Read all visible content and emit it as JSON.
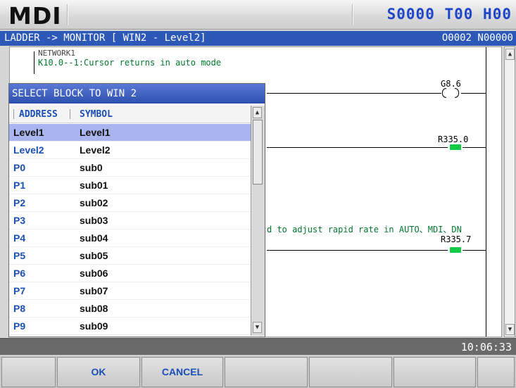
{
  "header": {
    "mode": "MDI",
    "status": "S0000 T00 H00"
  },
  "titlebar": {
    "path": "LADDER -> MONITOR [ WIN2 - Level2]",
    "program": "O0002 N00000"
  },
  "ladder": {
    "network_label": "NETWORK1",
    "comment1": "K10.0--1:Cursor returns in auto mode",
    "comment2": "d to adjust rapid rate in AUTO、MDI、DN",
    "coils": [
      {
        "addr": "G8.6",
        "active": false
      },
      {
        "addr": "R335.0",
        "active": true
      },
      {
        "addr": "R335.7",
        "active": true
      }
    ]
  },
  "dialog": {
    "title": "SELECT BLOCK TO WIN 2",
    "col_address": "ADDRESS",
    "col_symbol": "SYMBOL",
    "rows": [
      {
        "address": "Level1",
        "symbol": "Level1",
        "selected": true
      },
      {
        "address": "Level2",
        "symbol": "Level2",
        "selected": false
      },
      {
        "address": "P0",
        "symbol": "sub0",
        "selected": false
      },
      {
        "address": "P1",
        "symbol": "sub01",
        "selected": false
      },
      {
        "address": "P2",
        "symbol": "sub02",
        "selected": false
      },
      {
        "address": "P3",
        "symbol": "sub03",
        "selected": false
      },
      {
        "address": "P4",
        "symbol": "sub04",
        "selected": false
      },
      {
        "address": "P5",
        "symbol": "sub05",
        "selected": false
      },
      {
        "address": "P6",
        "symbol": "sub06",
        "selected": false
      },
      {
        "address": "P7",
        "symbol": "sub07",
        "selected": false
      },
      {
        "address": "P8",
        "symbol": "sub08",
        "selected": false
      },
      {
        "address": "P9",
        "symbol": "sub09",
        "selected": false
      }
    ]
  },
  "clock": "10:06:33",
  "softkeys": [
    "",
    "OK",
    "CANCEL",
    "",
    "",
    "",
    "",
    ""
  ]
}
